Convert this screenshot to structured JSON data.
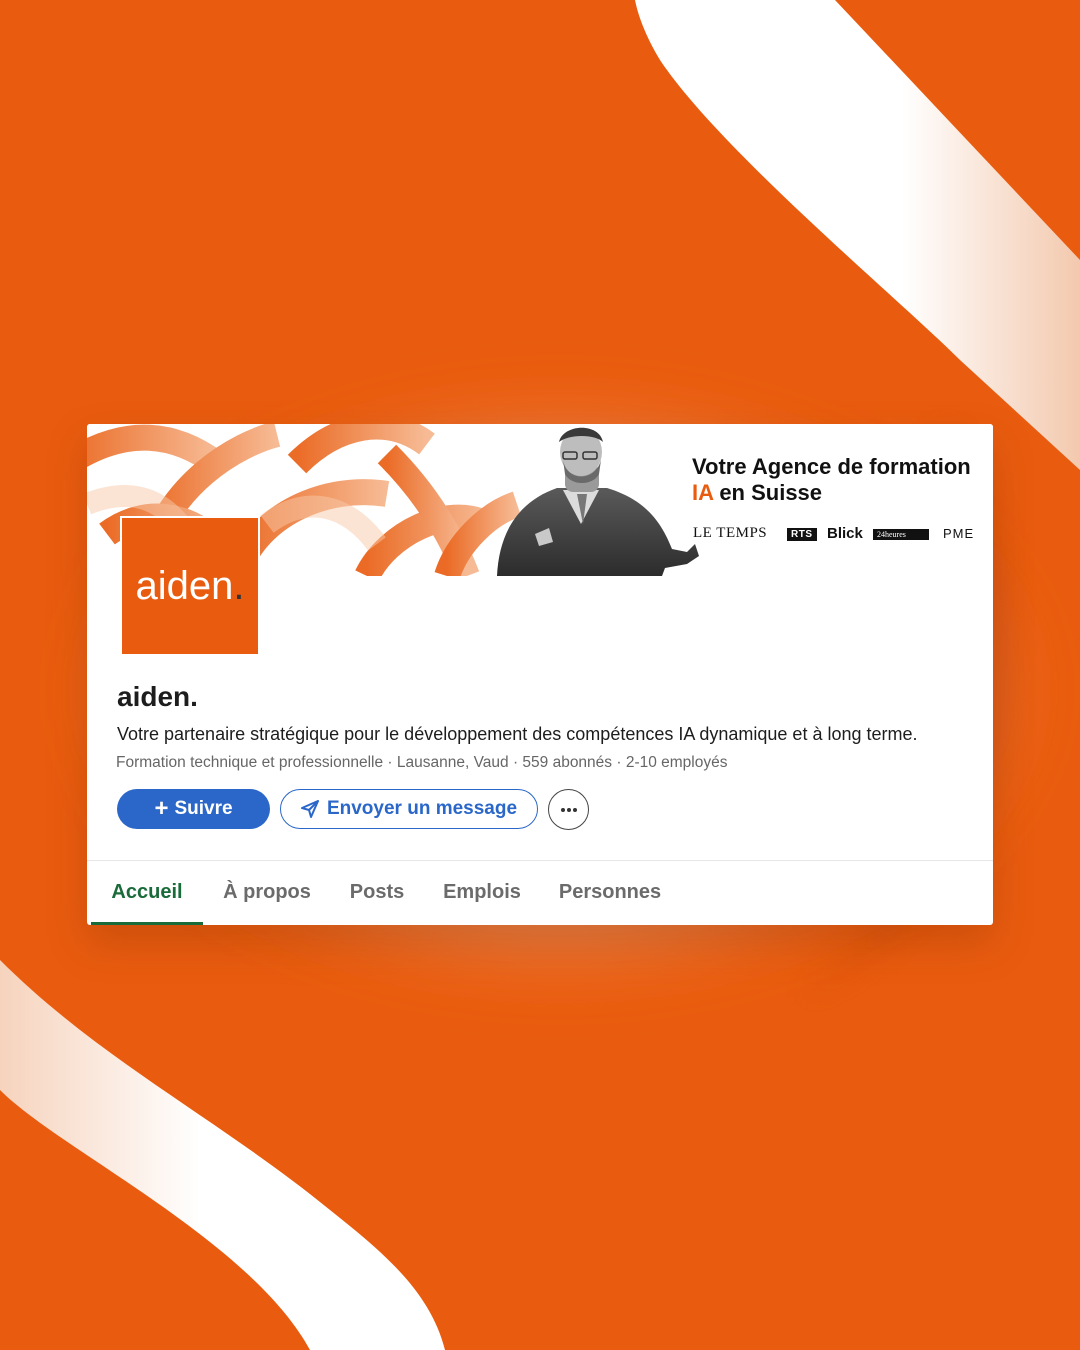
{
  "colors": {
    "background": "#e95c0f",
    "brand": "#e95c0f",
    "primary_button": "#2a67c9",
    "active_tab": "#1a6b3a"
  },
  "banner": {
    "title_line1": "Votre Agence de formation",
    "title_accent": "IA",
    "title_line2_rest": "en Suisse",
    "press": [
      "LE TEMPS",
      "RTS",
      "Blick",
      "24heures",
      "PME"
    ]
  },
  "logo": {
    "text": "aiden",
    "dot": "."
  },
  "company": {
    "name": "aiden.",
    "tagline": "Votre partenaire stratégique pour le développement des compétences IA dynamique et à long terme.",
    "meta": "Formation technique et professionnelle · Lausanne, Vaud · 559 abonnés · 2-10 employés"
  },
  "actions": {
    "follow_icon": "plus-icon",
    "follow_label": "Suivre",
    "message_icon": "send-icon",
    "message_label": "Envoyer un message",
    "more_icon": "more-icon"
  },
  "tabs": [
    {
      "label": "Accueil",
      "active": true
    },
    {
      "label": "À propos",
      "active": false
    },
    {
      "label": "Posts",
      "active": false
    },
    {
      "label": "Emplois",
      "active": false
    },
    {
      "label": "Personnes",
      "active": false
    }
  ]
}
